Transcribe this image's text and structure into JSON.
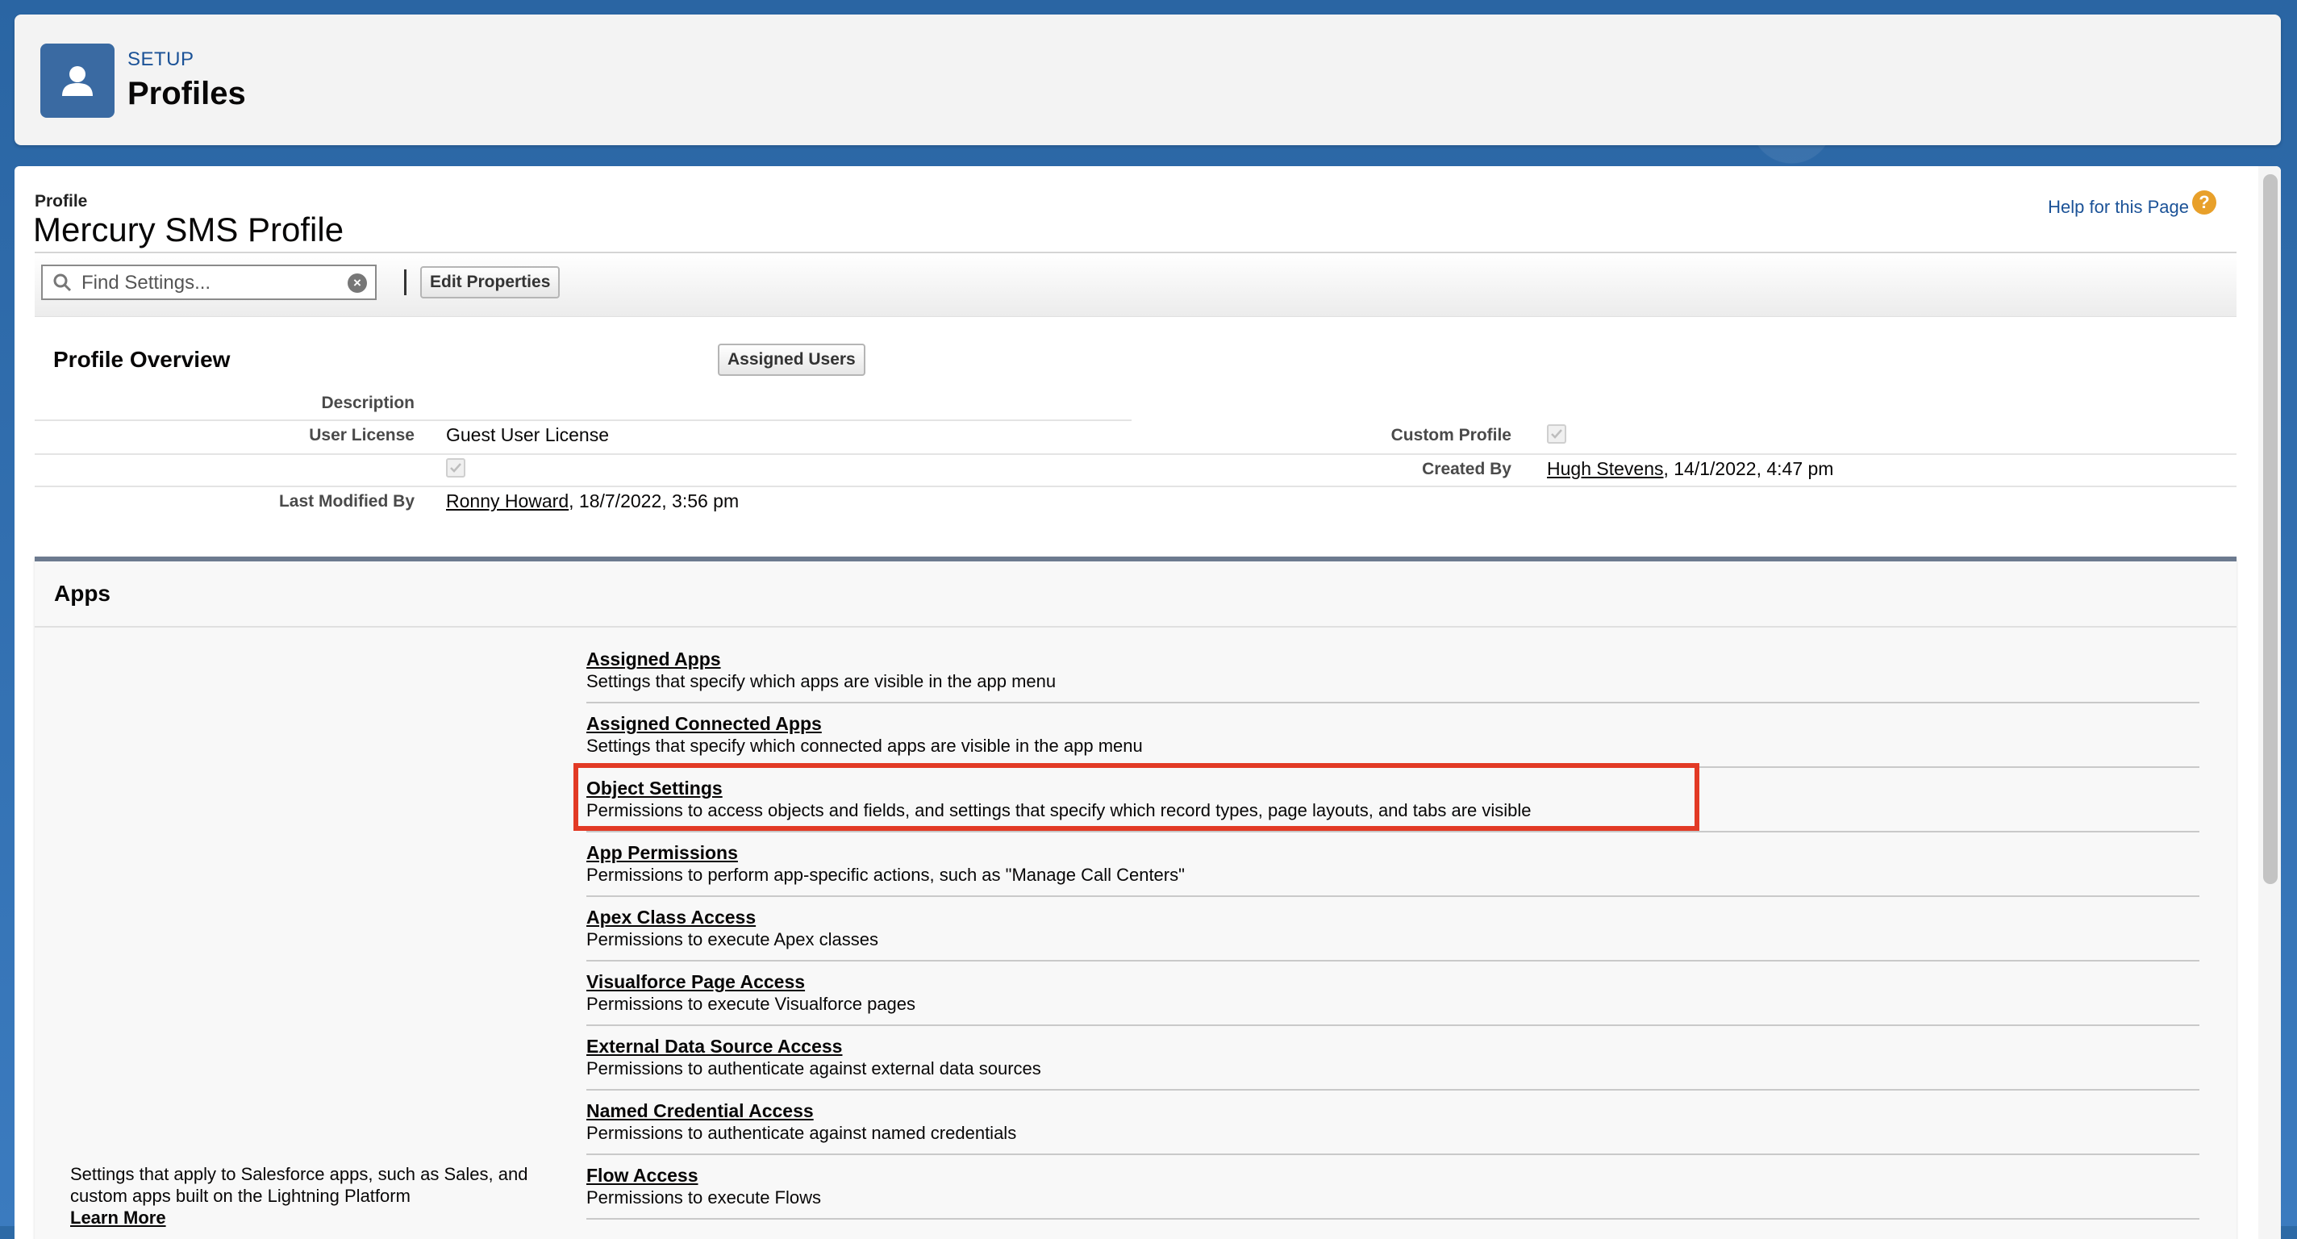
{
  "header": {
    "setup_label": "SETUP",
    "title": "Profiles",
    "icon": "user-icon"
  },
  "profile": {
    "label": "Profile",
    "name": "Mercury SMS Profile",
    "help_link": "Help for this Page",
    "help_icon_glyph": "?"
  },
  "toolbar": {
    "search_placeholder": "Find Settings...",
    "search_value": "",
    "edit_properties_label": "Edit Properties"
  },
  "overview": {
    "title": "Profile Overview",
    "assigned_users_label": "Assigned Users",
    "fields": {
      "description_label": "Description",
      "description_value": "",
      "user_license_label": "User License",
      "user_license_value": "Guest User License",
      "custom_profile_label": "Custom Profile",
      "custom_profile_checked": true,
      "unlabeled_checkbox_checked": true,
      "created_by_label": "Created By",
      "created_by_name": "Hugh Stevens",
      "created_by_date": ", 14/1/2022, 4:47 pm",
      "last_modified_label": "Last Modified By",
      "last_modified_name": "Ronny Howard",
      "last_modified_date": ", 18/7/2022, 3:56 pm"
    }
  },
  "apps": {
    "title": "Apps",
    "description": "Settings that apply to Salesforce apps, such as Sales, and custom apps built on the Lightning Platform",
    "learn_more": "Learn More",
    "items": [
      {
        "title": "Assigned Apps",
        "desc": "Settings that specify which apps are visible in the app menu"
      },
      {
        "title": "Assigned Connected Apps",
        "desc": "Settings that specify which connected apps are visible in the app menu"
      },
      {
        "title": "Object Settings",
        "desc": "Permissions to access objects and fields, and settings that specify which record types, page layouts, and tabs are visible",
        "highlighted": true
      },
      {
        "title": "App Permissions",
        "desc": "Permissions to perform app-specific actions, such as \"Manage Call Centers\""
      },
      {
        "title": "Apex Class Access",
        "desc": "Permissions to execute Apex classes"
      },
      {
        "title": "Visualforce Page Access",
        "desc": "Permissions to execute Visualforce pages"
      },
      {
        "title": "External Data Source Access",
        "desc": "Permissions to authenticate against external data sources"
      },
      {
        "title": "Named Credential Access",
        "desc": "Permissions to authenticate against named credentials"
      },
      {
        "title": "Flow Access",
        "desc": "Permissions to execute Flows"
      }
    ]
  },
  "colors": {
    "accent_link": "#1b5297",
    "highlight_border": "#e23a25",
    "header_icon_bg": "#3a6aa2"
  }
}
